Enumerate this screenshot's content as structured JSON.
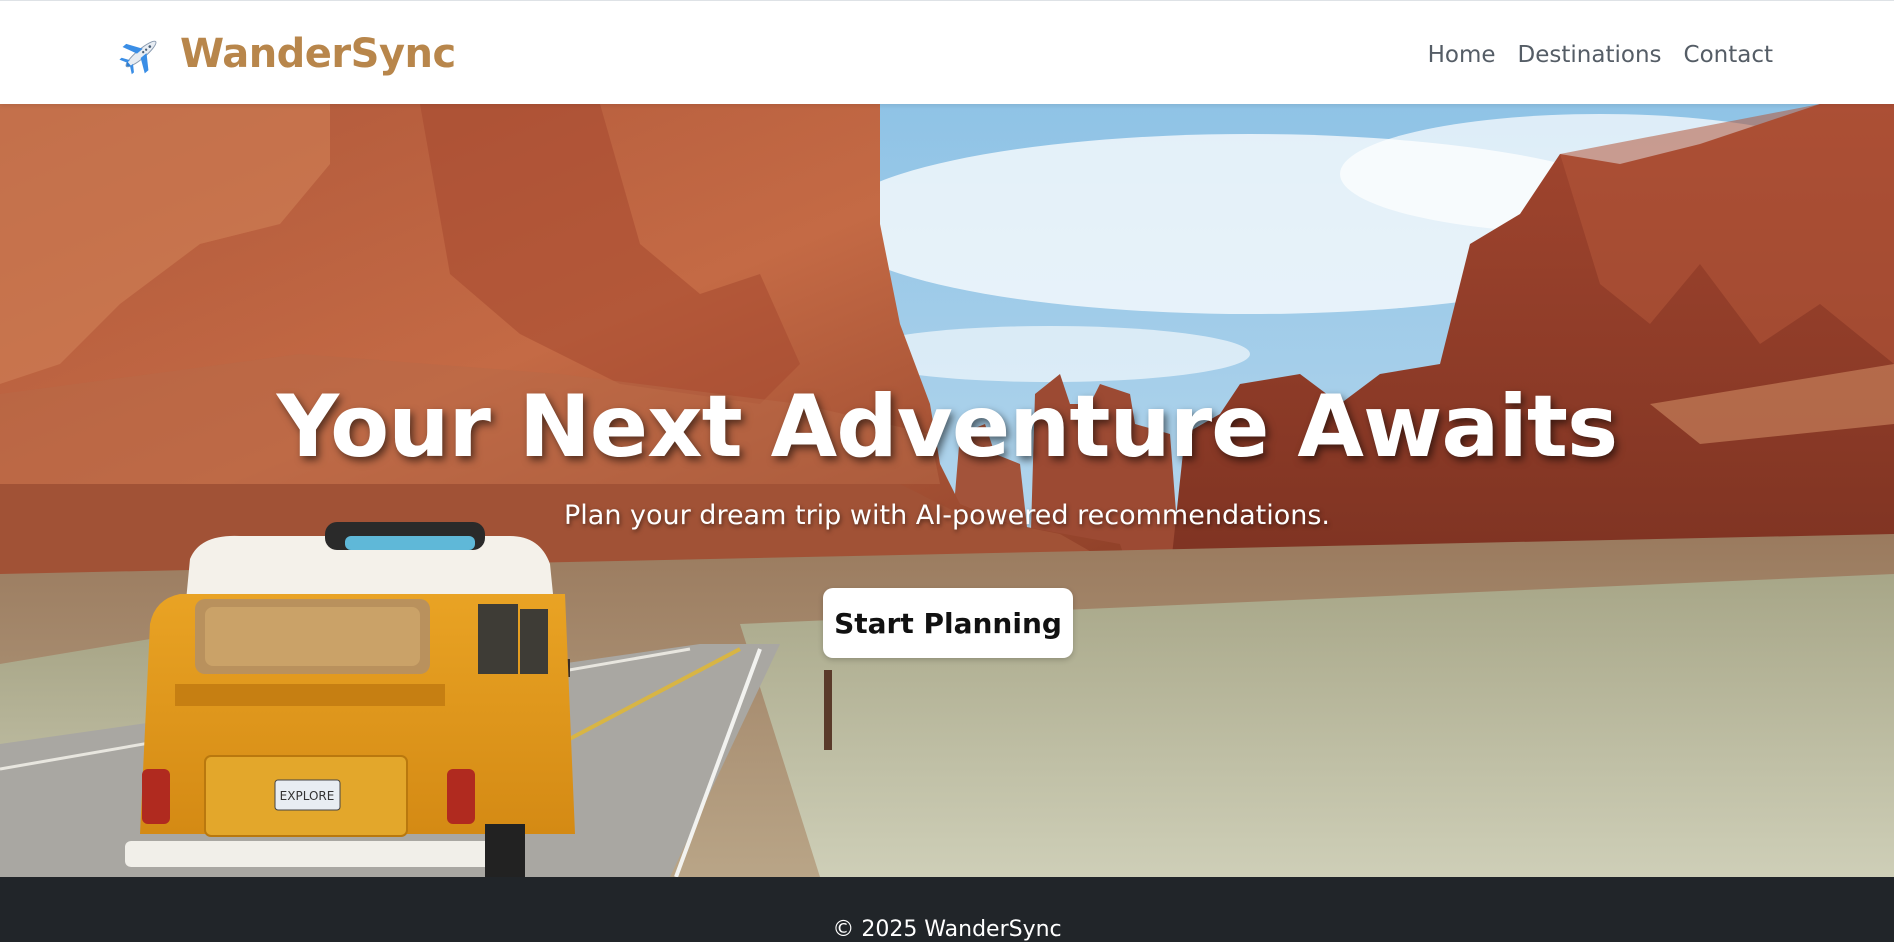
{
  "navbar": {
    "brand": "WanderSync",
    "brand_icon": "airplane-icon",
    "brand_color": "#b8864b",
    "links": [
      {
        "label": "Home"
      },
      {
        "label": "Destinations"
      },
      {
        "label": "Contact"
      }
    ]
  },
  "hero": {
    "title": "Your Next Adventure Awaits",
    "subtitle": "Plan your dream trip with AI-powered recommendations.",
    "cta_label": "Start Planning",
    "background": "desert-canyon-road-with-yellow-van-image",
    "van_plate": "EXPLORE"
  },
  "footer": {
    "text": "© 2025 WanderSync",
    "background": "#212529"
  }
}
